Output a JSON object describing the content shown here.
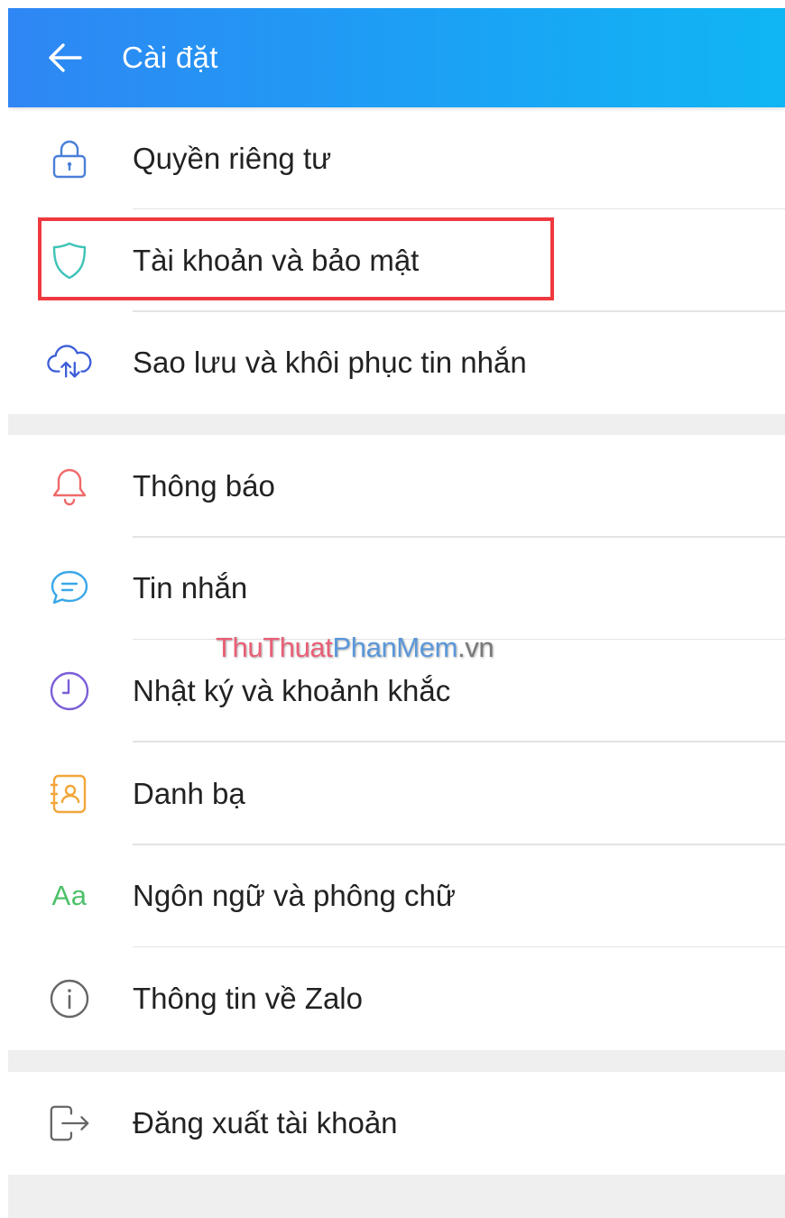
{
  "header": {
    "title": "Cài đặt",
    "back_icon": "arrow-left-icon"
  },
  "groups": [
    {
      "items": [
        {
          "label": "Quyền riêng tư",
          "icon": "lock-icon",
          "icon_color": "#4a7fd9"
        },
        {
          "label": "Tài khoản và bảo mật",
          "icon": "shield-icon",
          "icon_color": "#3fc3b7"
        },
        {
          "label": "Sao lưu và khôi phục tin nhắn",
          "icon": "cloud-sync-icon",
          "icon_color": "#3d5ed8"
        }
      ]
    },
    {
      "items": [
        {
          "label": "Thông báo",
          "icon": "bell-icon",
          "icon_color": "#ef6b6b"
        },
        {
          "label": "Tin nhắn",
          "icon": "chat-bubble-icon",
          "icon_color": "#3aa7e8"
        },
        {
          "label": "Nhật ký và khoảnh khắc",
          "icon": "clock-icon",
          "icon_color": "#7b5ed8"
        },
        {
          "label": "Danh bạ",
          "icon": "contact-book-icon",
          "icon_color": "#f3a63a"
        },
        {
          "label": "Ngôn ngữ và phông chữ",
          "icon": "font-icon",
          "icon_text": "Aa",
          "icon_color": "#4cc16a"
        },
        {
          "label": "Thông tin về Zalo",
          "icon": "info-icon",
          "icon_color": "#666666"
        }
      ]
    },
    {
      "items": [
        {
          "label": "Đăng xuất tài khoản",
          "icon": "logout-icon",
          "icon_color": "#666666"
        }
      ]
    }
  ],
  "highlight_color": "#ee3a3f",
  "watermark": {
    "part1": "ThuThuat",
    "part2": "PhanMem",
    "part3": ".vn"
  }
}
